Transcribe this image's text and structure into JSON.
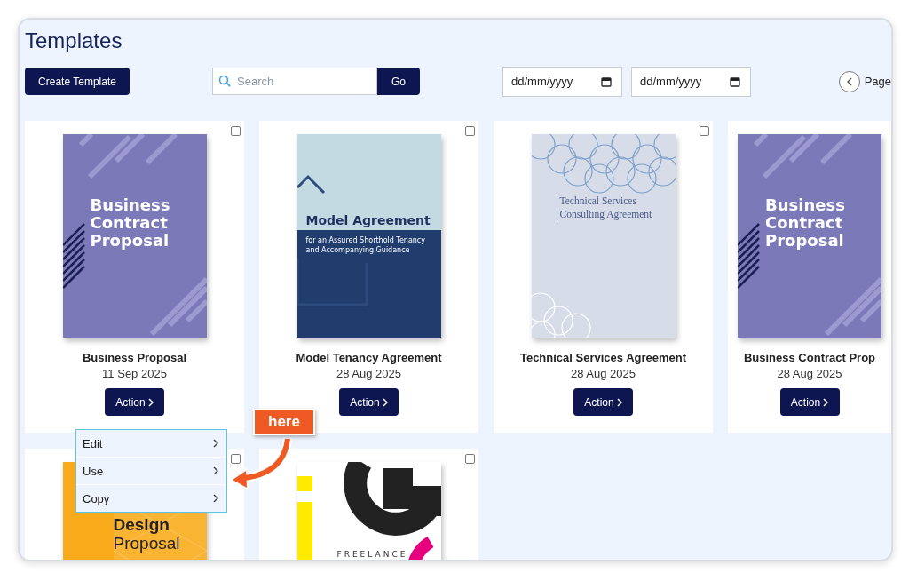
{
  "page_title": "Templates",
  "toolbar": {
    "create_button": "Create Template",
    "search": {
      "placeholder": "Search"
    },
    "go_button": "Go",
    "date_from": {
      "placeholder": "dd/mm/yyyy"
    },
    "date_to": {
      "placeholder": "dd/mm/yyyy"
    },
    "pager": {
      "label": "Page"
    }
  },
  "cards": [
    {
      "name": "Business Proposal",
      "date": "11 Sep 2025",
      "action": "Action",
      "checked": false,
      "thumbnail": {
        "kind": "purple",
        "texts": [
          "Business Contract Proposal"
        ]
      }
    },
    {
      "name": "Model Tenancy Agreement",
      "date": "28 Aug 2025",
      "action": "Action",
      "checked": false,
      "thumbnail": {
        "kind": "tenancy",
        "texts": [
          "Model Agreement",
          "for an Assured Shorthold Tenancy and Accompanying Guidance"
        ]
      }
    },
    {
      "name": "Technical Services Agreement",
      "date": "28 Aug 2025",
      "action": "Action",
      "checked": false,
      "thumbnail": {
        "kind": "circles",
        "texts": [
          "Technical Services Consulting Agreement"
        ]
      }
    },
    {
      "name": "Business Contract Prop",
      "date": "28 Aug 2025",
      "action": "Action",
      "thumbnail": {
        "kind": "purple",
        "texts": [
          "Business Contract Proposal"
        ]
      }
    },
    {
      "checked": false,
      "thumbnail": {
        "kind": "orange",
        "texts": [
          "Design",
          "Proposal"
        ]
      }
    },
    {
      "checked": false,
      "thumbnail": {
        "kind": "freelance",
        "texts": [
          "FREELANCE"
        ]
      }
    }
  ],
  "context_menu": {
    "items": [
      {
        "label": "Edit"
      },
      {
        "label": "Use"
      },
      {
        "label": "Copy"
      }
    ]
  },
  "callout": {
    "label": "here"
  }
}
